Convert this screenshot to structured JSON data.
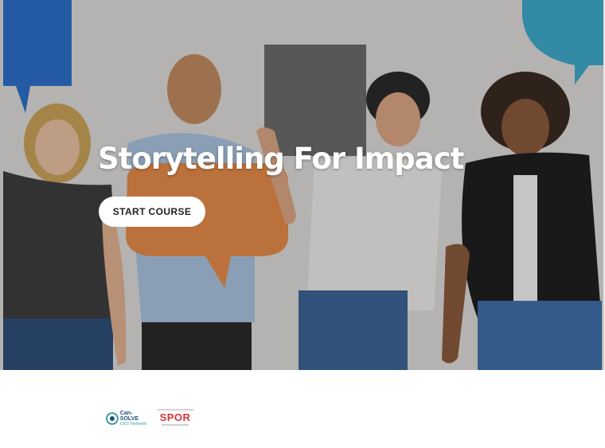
{
  "hero": {
    "title": "Storytelling For Impact",
    "button_label": "START COURSE"
  },
  "logos": {
    "cansolve": {
      "line1": "Can-SOLVE",
      "line2": "CKD Network"
    },
    "spor": {
      "mark": "SPOR"
    }
  },
  "colors": {
    "speech_bubble_blue": "#2d6fc8",
    "speech_bubble_orange": "#e58a49",
    "speech_bubble_teal": "#3fa9c9",
    "spor_red": "#d9333a",
    "button_bg": "#ffffff"
  }
}
